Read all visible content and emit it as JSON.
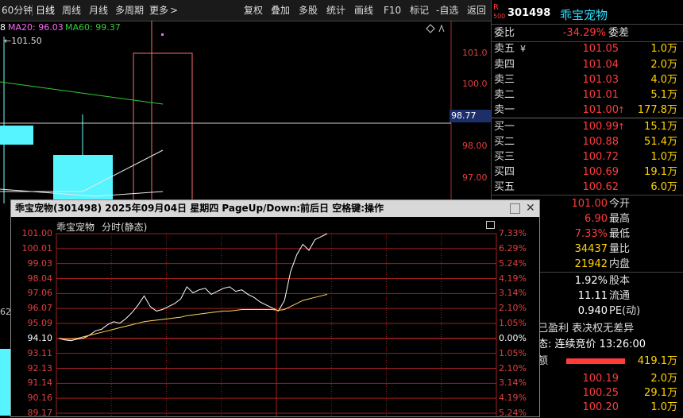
{
  "toolbar": {
    "left_items": [
      "60分钟",
      "日线",
      "周线",
      "月线",
      "多周期",
      "更多"
    ],
    "right_items": [
      "复权",
      "叠加",
      "多股",
      "统计",
      "画线",
      "F10",
      "标记",
      "-自选",
      "返回"
    ]
  },
  "main_chart": {
    "ma_labels": [
      {
        "text": "8",
        "color": "#ffffff"
      },
      {
        "text": "MA20: 96.03",
        "color": "#ff66ff"
      },
      {
        "text": "MA60: 99.37",
        "color": "#33cc33"
      }
    ],
    "high_label": "101.50",
    "y_ticks": [
      "101.0",
      "100.0",
      "98.00",
      "97.00"
    ],
    "current_price_label": "98.77",
    "left_edge_label": "62"
  },
  "right_panel": {
    "badge_top": "R",
    "badge_bottom": "500",
    "code": "301498",
    "name": "乖宝宠物",
    "weibi_label": "委比",
    "weibi_value": "-34.29%",
    "weicha_label": "委差",
    "sells": [
      {
        "label": "卖五",
        "mark": "¥",
        "price": "101.05",
        "vol": "1.0万"
      },
      {
        "label": "卖四",
        "mark": "",
        "price": "101.04",
        "vol": "2.0万"
      },
      {
        "label": "卖三",
        "mark": "",
        "price": "101.03",
        "vol": "4.0万"
      },
      {
        "label": "卖二",
        "mark": "",
        "price": "101.01",
        "vol": "5.1万"
      },
      {
        "label": "卖一",
        "mark": "",
        "price": "101.00",
        "vol": "177.8万"
      }
    ],
    "buys": [
      {
        "label": "买一",
        "price": "100.99",
        "vol": "15.1万"
      },
      {
        "label": "买二",
        "price": "100.88",
        "vol": "51.4万"
      },
      {
        "label": "买三",
        "price": "100.72",
        "vol": "1.0万"
      },
      {
        "label": "买四",
        "price": "100.69",
        "vol": "19.1万"
      },
      {
        "label": "买五",
        "price": "100.62",
        "vol": "6.0万"
      }
    ],
    "stats": [
      {
        "value": "101.00",
        "label": "今开",
        "color": "#ff3b3b"
      },
      {
        "value": "6.90",
        "label": "最高",
        "color": "#ff3b3b"
      },
      {
        "value": "7.33%",
        "label": "最低",
        "color": "#ff3b3b"
      },
      {
        "value": "34437",
        "label": "量比",
        "color": "#ffd400"
      },
      {
        "value": "21942",
        "label": "内盘",
        "color": "#ffd400"
      },
      {
        "value": "1.92%",
        "label": "股本",
        "color": "#ffffff"
      },
      {
        "value": "11.11",
        "label": "流通",
        "color": "#ffffff"
      },
      {
        "value": "0.940",
        "label": "PE(动)",
        "color": "#ffffff"
      }
    ],
    "notice1": "已盈利 表决权无差异",
    "notice2": "态: 连续竞价 13:26:00",
    "bid_header_label": "额",
    "bid_header_vol": "419.1万",
    "trades": [
      {
        "price": "100.19",
        "vol": "2.0万"
      },
      {
        "price": "100.25",
        "vol": "29.1万"
      },
      {
        "price": "100.20",
        "vol": "1.0万"
      }
    ]
  },
  "popup": {
    "title": "乖宝宠物(301498)  2025年09月04日 星期四 PageUp/Down:前后日 空格键:操作",
    "chart_name": "乖宝宠物",
    "chart_mode": "分时(静态)",
    "left_ticks": [
      "101.00",
      "100.01",
      "99.03",
      "98.04",
      "97.06",
      "96.07",
      "95.09",
      "94.10",
      "93.11",
      "92.13",
      "91.14",
      "90.16",
      "89.17"
    ],
    "right_ticks": [
      "7.33%",
      "6.29%",
      "5.24%",
      "4.19%",
      "3.14%",
      "2.10%",
      "1.05%",
      "0.00%",
      "1.05%",
      "2.10%",
      "3.14%",
      "4.19%",
      "5.24%"
    ]
  },
  "chart_data": {
    "type": "line",
    "title": "",
    "xlabel": "",
    "ylabel": "",
    "ylim": [
      89.17,
      101.0
    ],
    "series": [
      {
        "values": [
          94.1,
          94.0,
          93.95,
          94.05,
          94.1,
          94.3,
          94.6,
          94.7,
          95.0,
          95.2,
          95.1,
          95.4,
          95.8,
          96.3,
          96.9,
          96.2,
          95.9,
          96.0,
          96.2,
          96.4,
          96.7,
          97.5,
          97.1,
          97.3,
          97.4,
          97.0,
          97.2,
          97.4,
          97.5,
          97.2,
          97.3,
          97.0,
          96.8,
          96.5,
          96.3,
          96.1,
          95.9,
          96.6,
          98.5,
          99.6,
          100.3,
          99.9,
          100.6,
          100.8,
          101.0
        ]
      },
      {
        "values": [
          94.1,
          94.05,
          94.05,
          94.1,
          94.2,
          94.3,
          94.4,
          94.5,
          94.6,
          94.7,
          94.8,
          94.9,
          95.0,
          95.1,
          95.2,
          95.25,
          95.3,
          95.35,
          95.4,
          95.45,
          95.5,
          95.6,
          95.65,
          95.7,
          95.75,
          95.8,
          95.85,
          95.9,
          95.9,
          95.95,
          96.0,
          96.0,
          96.0,
          96.0,
          96.0,
          96.0,
          95.95,
          96.0,
          96.2,
          96.4,
          96.6,
          96.7,
          96.8,
          96.9,
          97.0
        ]
      }
    ]
  }
}
